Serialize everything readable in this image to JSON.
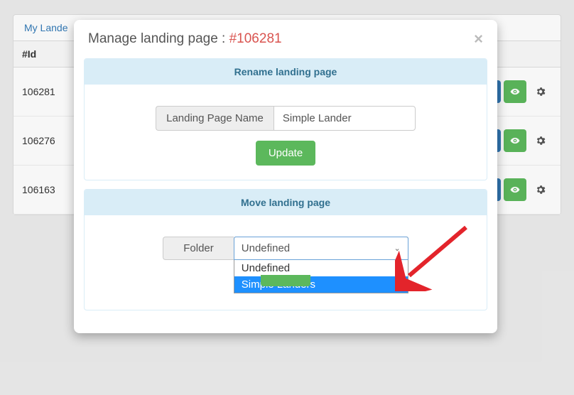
{
  "background": {
    "tab_label": "My Lande",
    "header_id": "#Id",
    "rows": [
      {
        "id": "106281"
      },
      {
        "id": "106276"
      },
      {
        "id": "106163"
      }
    ]
  },
  "modal": {
    "title_prefix": "Manage landing page : ",
    "title_id": "#106281",
    "close_glyph": "×",
    "rename": {
      "heading": "Rename landing page",
      "field_label": "Landing Page Name",
      "field_value": "Simple Lander",
      "button": "Update"
    },
    "move": {
      "heading": "Move landing page",
      "field_label": "Folder",
      "selected_value": "Undefined",
      "options": [
        {
          "label": "Undefined",
          "selected": false
        },
        {
          "label": "Simple Landers",
          "selected": true
        }
      ]
    }
  },
  "colors": {
    "info_bg": "#d9edf7",
    "info_text": "#31708f",
    "danger": "#d9534f",
    "success": "#5cb85c",
    "primary": "#337ab7"
  }
}
